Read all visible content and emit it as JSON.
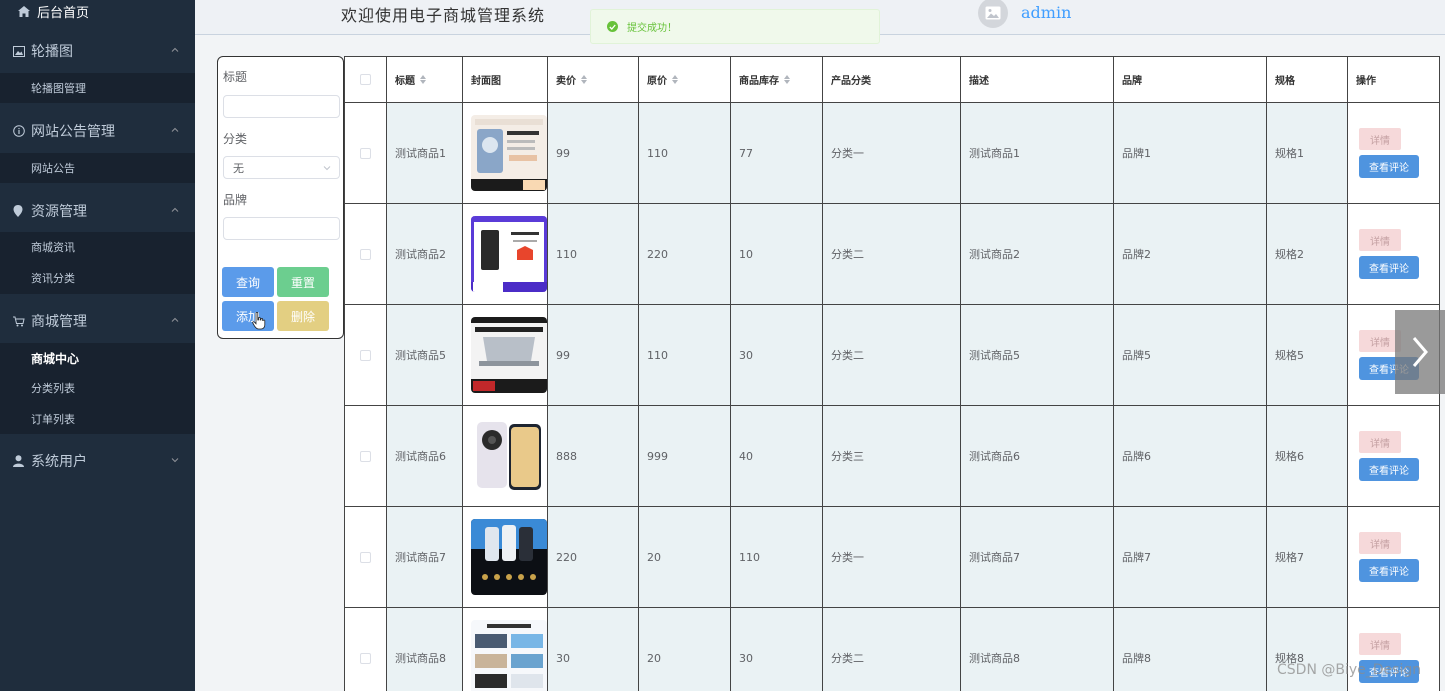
{
  "sidebar": {
    "home_label": "后台首页",
    "sections": [
      {
        "label": "轮播图",
        "items": [
          {
            "label": "轮播图管理"
          }
        ]
      },
      {
        "label": "网站公告管理",
        "items": [
          {
            "label": "网站公告"
          }
        ]
      },
      {
        "label": "资源管理",
        "items": [
          {
            "label": "商城资讯"
          },
          {
            "label": "资讯分类"
          }
        ]
      },
      {
        "label": "商城管理",
        "items": [
          {
            "label": "商城中心",
            "active": true
          },
          {
            "label": "分类列表"
          },
          {
            "label": "订单列表"
          }
        ]
      },
      {
        "label": "系统用户",
        "items": []
      }
    ]
  },
  "header": {
    "title": "欢迎使用电子商城管理系统",
    "username": "admin"
  },
  "toast": {
    "message": "提交成功！"
  },
  "search": {
    "title_label": "标题",
    "title_value": "",
    "category_label": "分类",
    "category_value": "无",
    "brand_label": "品牌",
    "brand_value": "",
    "query_button": "查询",
    "reset_button": "重置",
    "add_button": "添加",
    "delete_button": "删除"
  },
  "table": {
    "headers": [
      "",
      "标题",
      "封面图",
      "卖价",
      "原价",
      "商品库存",
      "产品分类",
      "描述",
      "品牌",
      "规格",
      "操作"
    ],
    "rows": [
      {
        "title": "测试商品1",
        "price": "99",
        "original": "110",
        "stock": "77",
        "category": "分类一",
        "desc": "测试商品1",
        "brand": "品牌1",
        "spec": "规格1"
      },
      {
        "title": "测试商品2",
        "price": "110",
        "original": "220",
        "stock": "10",
        "category": "分类二",
        "desc": "测试商品2",
        "brand": "品牌2",
        "spec": "规格2"
      },
      {
        "title": "测试商品5",
        "price": "99",
        "original": "110",
        "stock": "30",
        "category": "分类二",
        "desc": "测试商品5",
        "brand": "品牌5",
        "spec": "规格5"
      },
      {
        "title": "测试商品6",
        "price": "888",
        "original": "999",
        "stock": "40",
        "category": "分类三",
        "desc": "测试商品6",
        "brand": "品牌6",
        "spec": "规格6"
      },
      {
        "title": "测试商品7",
        "price": "220",
        "original": "20",
        "stock": "110",
        "category": "分类一",
        "desc": "测试商品7",
        "brand": "品牌7",
        "spec": "规格7"
      },
      {
        "title": "测试商品8",
        "price": "30",
        "original": "20",
        "stock": "30",
        "category": "分类二",
        "desc": "测试商品8",
        "brand": "品牌8",
        "spec": "规格8"
      }
    ],
    "detail_label": "详情",
    "review_label": "查看评论"
  },
  "watermark": "CSDN @Biye_Design",
  "colors": {
    "sidebar_bg": "#1f2d3d",
    "primary": "#409eff",
    "success": "#67c23a"
  }
}
